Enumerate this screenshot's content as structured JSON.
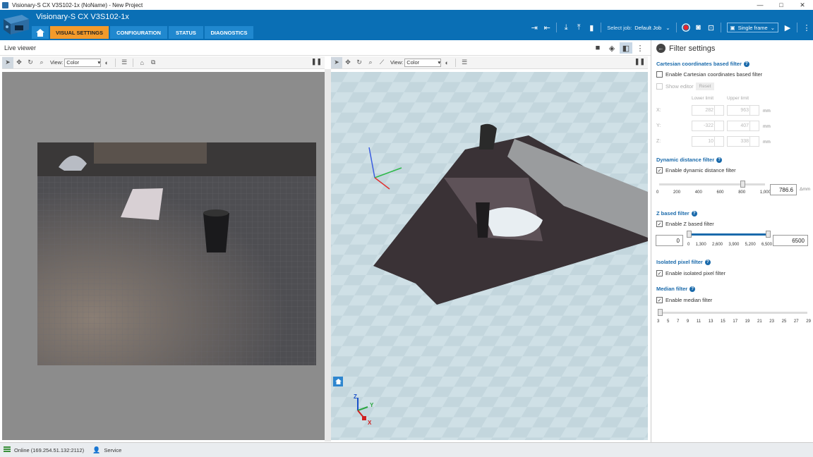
{
  "window": {
    "title": "Visionary-S CX V3S102-1x (NoName) - New Project",
    "controls": [
      "—",
      "□",
      "✕"
    ]
  },
  "header": {
    "device_name": "Visionary-S CX V3S102-1x",
    "tabs": [
      {
        "label": "VISUAL SETTINGS",
        "active": true
      },
      {
        "label": "CONFIGURATION",
        "active": false
      },
      {
        "label": "STATUS",
        "active": false
      },
      {
        "label": "DIAGNOSTICS",
        "active": false
      }
    ],
    "select_job_label": "Select job:",
    "job_value": "Default Job",
    "frame_mode": "Single frame"
  },
  "live_viewer": {
    "title": "Live viewer"
  },
  "viewer_2d": {
    "view_label": "View:",
    "view_value": "Color"
  },
  "viewer_3d": {
    "view_label": "View:",
    "view_value": "Color",
    "axis_labels": {
      "x": "X",
      "y": "Y",
      "z": "Z"
    }
  },
  "filter_panel": {
    "title": "Filter settings",
    "cartesian": {
      "title": "Cartesian coordinates based filter",
      "enable_label": "Enable Cartesian coordinates based filter",
      "enabled": false,
      "show_editor_label": "Show editor",
      "reset_label": "Reset",
      "lower_label": "Lower limit",
      "upper_label": "Upper limit",
      "rows": [
        {
          "axis": "X:",
          "lower": "282",
          "upper": "963",
          "unit": "mm"
        },
        {
          "axis": "Y:",
          "lower": "-322",
          "upper": "407",
          "unit": "mm"
        },
        {
          "axis": "Z:",
          "lower": "10",
          "upper": "338",
          "unit": "mm"
        }
      ]
    },
    "dynamic": {
      "title": "Dynamic distance filter",
      "enable_label": "Enable dynamic distance filter",
      "enabled": true,
      "ticks": [
        "0",
        "200",
        "400",
        "600",
        "800",
        "1,000"
      ],
      "value": "786.6",
      "slider_fraction": 0.787,
      "unit": "Δmm"
    },
    "zfilter": {
      "title": "Z based filter",
      "enable_label": "Enable Z based filter",
      "enabled": true,
      "min_value": "0",
      "max_value": "6500",
      "ticks": [
        "0",
        "1,300",
        "2,600",
        "3,900",
        "5,200",
        "6,500"
      ],
      "unit": "mm"
    },
    "isolated": {
      "title": "Isolated pixel filter",
      "enable_label": "Enable isolated pixel filter",
      "enabled": true
    },
    "median": {
      "title": "Median filter",
      "enable_label": "Enable median filter",
      "enabled": true,
      "ticks": [
        "3",
        "5",
        "7",
        "9",
        "11",
        "13",
        "15",
        "17",
        "19",
        "21",
        "23",
        "25",
        "27",
        "29"
      ]
    }
  },
  "status_bar": {
    "connection": "Online (169.254.51.132:2112)",
    "user": "Service"
  }
}
